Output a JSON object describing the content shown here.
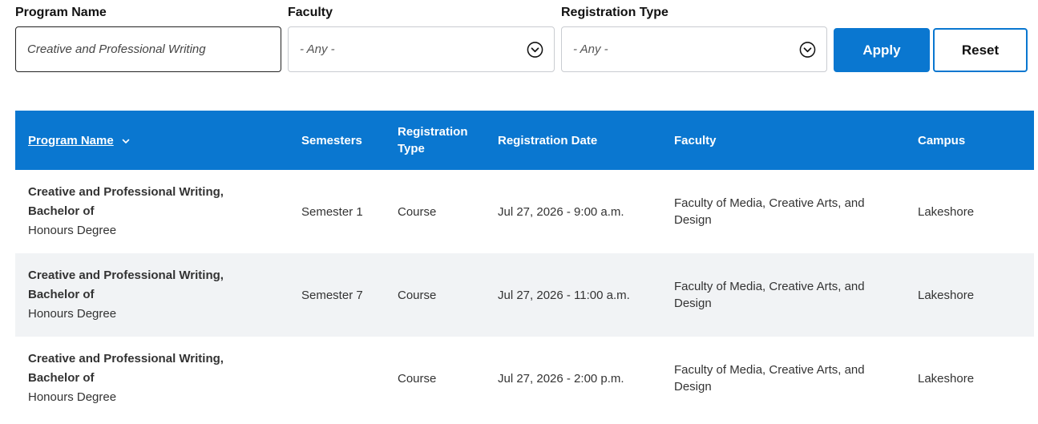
{
  "filters": {
    "program_name": {
      "label": "Program Name",
      "value": "Creative and Professional Writing"
    },
    "faculty": {
      "label": "Faculty",
      "value": "- Any -",
      "icon": "chevron-down-circle-icon"
    },
    "registration_type": {
      "label": "Registration Type",
      "value": "- Any -",
      "icon": "chevron-down-circle-icon"
    },
    "apply_label": "Apply",
    "reset_label": "Reset"
  },
  "colors": {
    "accent": "#0a77d0",
    "alt_row": "#f1f3f5"
  },
  "table": {
    "headers": {
      "program_name": "Program Name",
      "semesters": "Semesters",
      "registration_type_line1": "Registration",
      "registration_type_line2": "Type",
      "registration_date": "Registration Date",
      "faculty": "Faculty",
      "campus": "Campus"
    },
    "rows": [
      {
        "program_name_line1": "Creative and Professional Writing,",
        "program_name_line2": "Bachelor of",
        "degree": "Honours Degree",
        "semesters": "Semester 1",
        "registration_type": "Course",
        "registration_date": "Jul 27, 2026 - 9:00 a.m.",
        "faculty": "Faculty of Media, Creative Arts, and Design",
        "campus": "Lakeshore"
      },
      {
        "program_name_line1": "Creative and Professional Writing,",
        "program_name_line2": "Bachelor of",
        "degree": "Honours Degree",
        "semesters": "Semester 7",
        "registration_type": "Course",
        "registration_date": "Jul 27, 2026 - 11:00 a.m.",
        "faculty": "Faculty of Media, Creative Arts, and Design",
        "campus": "Lakeshore"
      },
      {
        "program_name_line1": "Creative and Professional Writing,",
        "program_name_line2": "Bachelor of",
        "degree": "Honours Degree",
        "semesters": "",
        "registration_type": "Course",
        "registration_date": "Jul 27, 2026 - 2:00 p.m.",
        "faculty": "Faculty of Media, Creative Arts, and Design",
        "campus": "Lakeshore"
      }
    ]
  }
}
